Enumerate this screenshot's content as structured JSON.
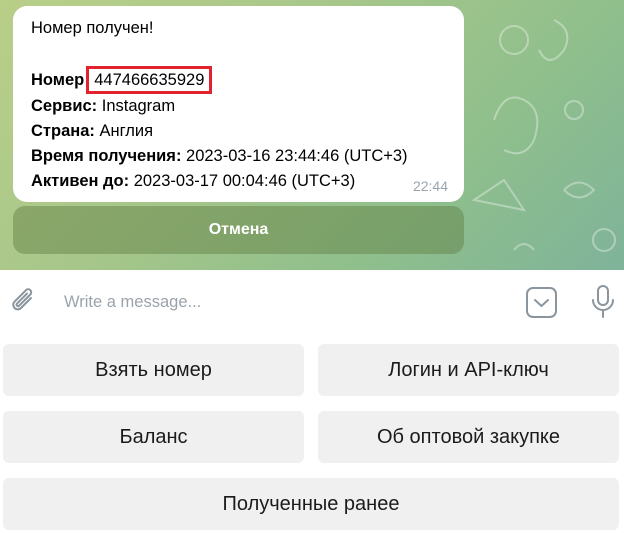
{
  "message": {
    "header": "Номер получен!",
    "number_label": "Номер",
    "number_value": "447466635929",
    "service_label": "Сервис:",
    "service_value": "Instagram",
    "country_label": "Страна:",
    "country_value": "Англия",
    "received_label": "Время получения:",
    "received_value": "2023-03-16 23:44:46 (UTC+3)",
    "active_label": "Активен до:",
    "active_value": "2023-03-17 00:04:46 (UTC+3)",
    "time": "22:44"
  },
  "inline_button": {
    "label": "Отмена"
  },
  "composer": {
    "placeholder": "Write a message..."
  },
  "reply_keyboard": {
    "take_number": "Взять номер",
    "login_api": "Логин и API-ключ",
    "balance": "Баланс",
    "wholesale": "Об оптовой закупке",
    "received_earlier": "Полученные ранее"
  },
  "colors": {
    "highlight_box": "#e0232f",
    "wallpaper": "#a9c78a",
    "key_background": "#f0f0f0"
  },
  "icons": [
    "paperclip-icon",
    "keyboard-toggle-icon",
    "microphone-icon"
  ]
}
